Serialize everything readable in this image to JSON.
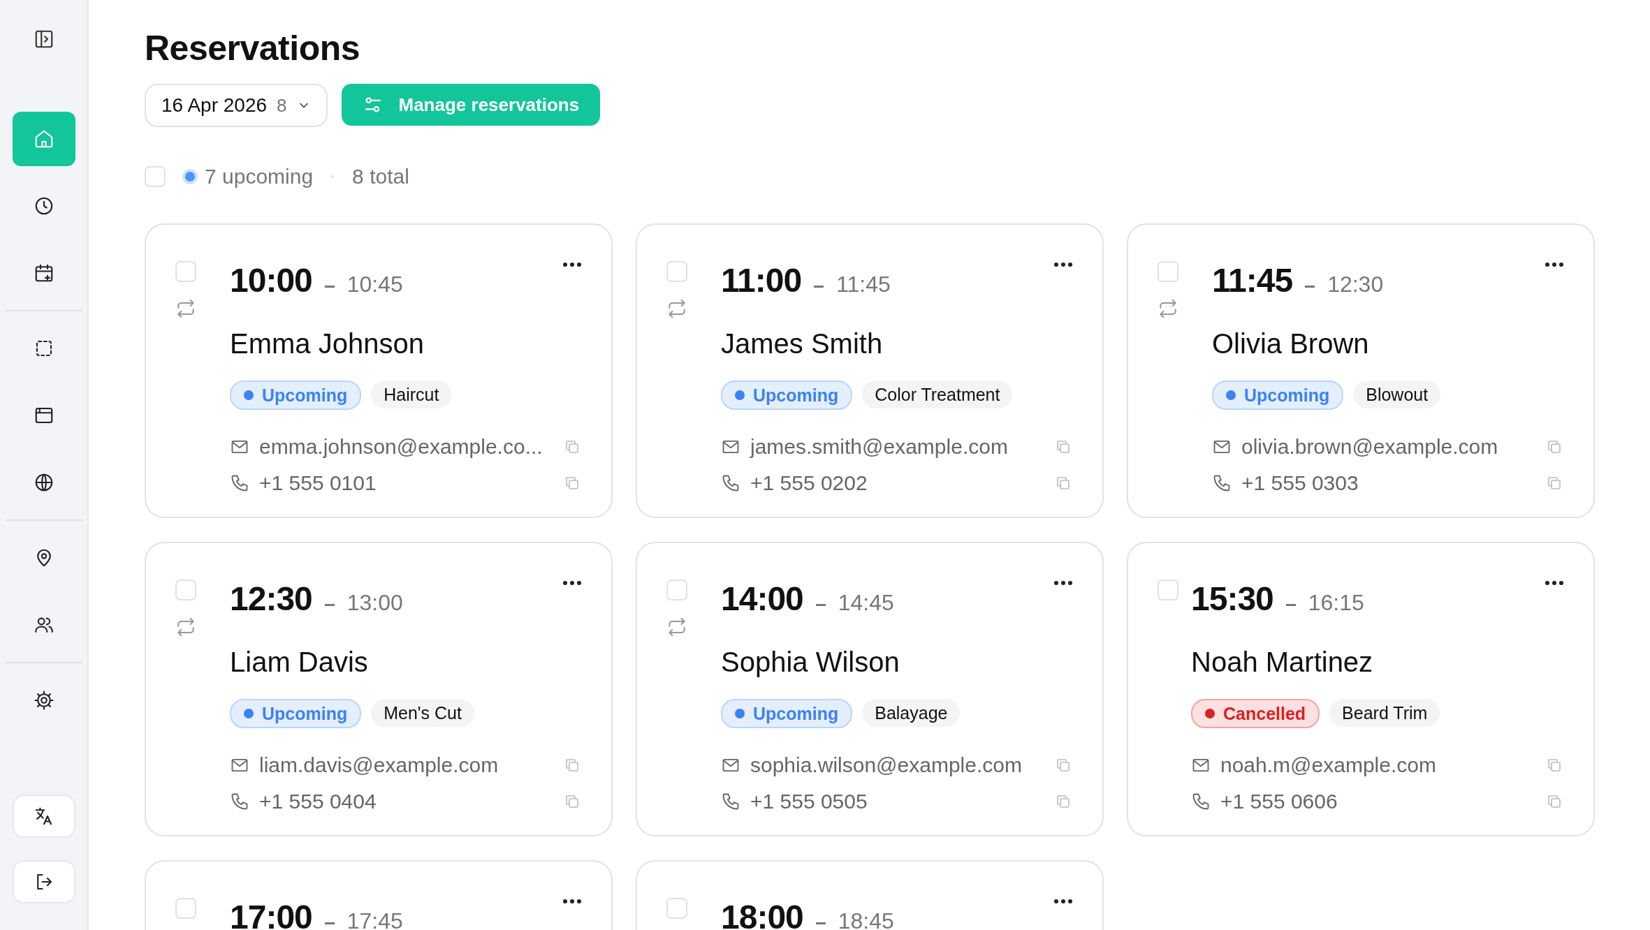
{
  "sidebar": {
    "groups": [
      [
        {
          "selected": true
        },
        {
          "selected": false
        },
        {
          "selected": false
        }
      ],
      [
        {
          "selected": false
        },
        {
          "selected": false
        },
        {
          "selected": false
        }
      ],
      [
        {
          "selected": false
        },
        {
          "selected": false
        }
      ],
      [
        {
          "selected": false
        }
      ]
    ]
  },
  "page": {
    "title": "Reservations"
  },
  "date_picker": {
    "value": "16 Apr 2026",
    "count": "8"
  },
  "manage_button": {
    "label": "Manage reservations"
  },
  "summary": {
    "select_all_checked": false,
    "upcoming": "7 upcoming",
    "total": "8 total"
  },
  "reservations": [
    {
      "start": "10:00",
      "end": "10:45",
      "name": "Emma Johnson",
      "kind": "upcoming",
      "status_label": "Upcoming",
      "service": "Haircut",
      "email": "emma.johnson@example.co...",
      "phone": "+1 555 0101",
      "recurring": true,
      "checked": false
    },
    {
      "start": "11:00",
      "end": "11:45",
      "name": "James Smith",
      "kind": "upcoming",
      "status_label": "Upcoming",
      "service": "Color Treatment",
      "email": "james.smith@example.com",
      "phone": "+1 555 0202",
      "recurring": true,
      "checked": false
    },
    {
      "start": "11:45",
      "end": "12:30",
      "name": "Olivia Brown",
      "kind": "upcoming",
      "status_label": "Upcoming",
      "service": "Blowout",
      "email": "olivia.brown@example.com",
      "phone": "+1 555 0303",
      "recurring": true,
      "checked": false
    },
    {
      "start": "12:30",
      "end": "13:00",
      "name": "Liam Davis",
      "kind": "upcoming",
      "status_label": "Upcoming",
      "service": "Men's Cut",
      "email": "liam.davis@example.com",
      "phone": "+1 555 0404",
      "recurring": true,
      "checked": false
    },
    {
      "start": "14:00",
      "end": "14:45",
      "name": "Sophia Wilson",
      "kind": "upcoming",
      "status_label": "Upcoming",
      "service": "Balayage",
      "email": "sophia.wilson@example.com",
      "phone": "+1 555 0505",
      "recurring": true,
      "checked": false
    },
    {
      "start": "15:30",
      "end": "16:15",
      "name": "Noah Martinez",
      "kind": "cancelled",
      "status_label": "Cancelled",
      "service": "Beard Trim",
      "email": "noah.m@example.com",
      "phone": "+1 555 0606",
      "recurring": false,
      "checked": false
    },
    {
      "start": "17:00",
      "end": "17:45",
      "checked": false
    },
    {
      "start": "18:00",
      "end": "18:45",
      "checked": false
    }
  ]
}
